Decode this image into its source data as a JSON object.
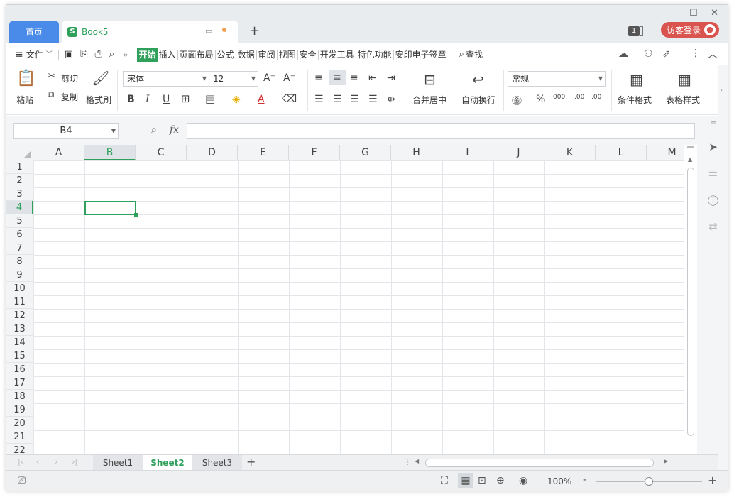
{
  "titlebar": {
    "home_tab": "首页",
    "doc_tab": "Book5",
    "doc_icon": "S",
    "new_tab_label": "+",
    "badge_count": "1",
    "login_label": "访客登录"
  },
  "menubar": {
    "file_label": "文件",
    "more_label": "»",
    "tabs": [
      "开始",
      "插入",
      "页面布局",
      "公式",
      "数据",
      "审阅",
      "视图",
      "安全",
      "开发工具",
      "特色功能",
      "安印电子签章"
    ],
    "active_tab": "开始",
    "search_label": "查找"
  },
  "ribbon": {
    "paste_label": "粘贴",
    "cut_label": "剪切",
    "copy_label": "复制",
    "format_painter_label": "格式刷",
    "font_name": "宋体",
    "font_size": "12",
    "bold": "B",
    "italic": "I",
    "underline": "U",
    "font_color_glyph": "A",
    "merge_center_label": "合并居中",
    "wrap_text_label": "自动换行",
    "number_format": "常规",
    "percent_glyph": "%",
    "thousands_glyph": "000",
    "dec_inc_glyph": ".00",
    "dec_dec_glyph": ".00",
    "cond_format_label": "条件格式",
    "table_style_label": "表格样式",
    "grow_font_glyph": "A⁺",
    "shrink_font_glyph": "A⁻"
  },
  "formula_bar": {
    "name_box": "B4",
    "fx_label": "fx",
    "formula_value": ""
  },
  "grid": {
    "columns": [
      "A",
      "B",
      "C",
      "D",
      "E",
      "F",
      "G",
      "H",
      "I",
      "J",
      "K",
      "L",
      "M"
    ],
    "rows": [
      "1",
      "2",
      "3",
      "4",
      "5",
      "6",
      "7",
      "8",
      "9",
      "10",
      "11",
      "12",
      "13",
      "14",
      "15",
      "16",
      "17",
      "18",
      "19",
      "20",
      "21",
      "22"
    ],
    "selected_cell": "B4",
    "selected_column": "B",
    "selected_row": "4"
  },
  "sheets": {
    "tabs": [
      "Sheet1",
      "Sheet2",
      "Sheet3"
    ],
    "active": "Sheet2",
    "add_label": "+"
  },
  "statusbar": {
    "zoom": "100%",
    "zoom_fraction": 0.5,
    "zoom_in_label": "+",
    "zoom_out_label": "-"
  },
  "colors": {
    "accent_green": "#2ea05a",
    "tab_blue": "#4a8ae8",
    "login_red": "#d9534f"
  }
}
